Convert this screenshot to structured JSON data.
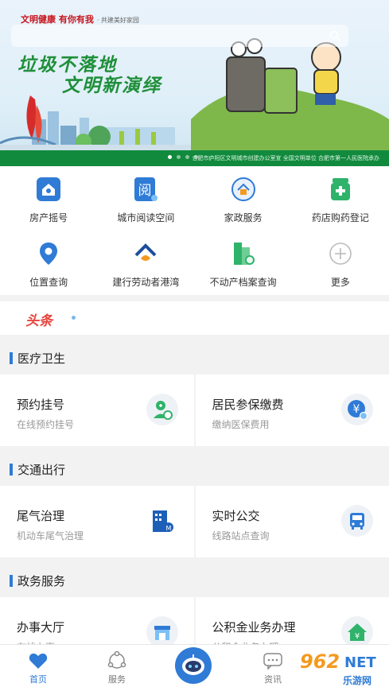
{
  "banner": {
    "topline": "文明健康 有你有我",
    "topline_small": "· 共建美好家园",
    "slogan_line1": "垃圾不落地",
    "slogan_line2": "文明新演绎",
    "strip_text": "合肥市庐阳区文明城市创建办公室宣  全国文明单位  合肥市第一人民医院承办",
    "dots_count": 4,
    "active_dot": 1
  },
  "grid": {
    "items": [
      {
        "label": "房产摇号",
        "icon": "house-lottery-icon",
        "color": "#2f7bd6"
      },
      {
        "label": "城市阅读空间",
        "icon": "reading-icon",
        "color": "#2f7bd6"
      },
      {
        "label": "家政服务",
        "icon": "housekeeping-icon",
        "color": "#2f7bd6"
      },
      {
        "label": "药店购药登记",
        "icon": "pharmacy-icon",
        "color": "#2fb36a"
      },
      {
        "label": "位置查询",
        "icon": "location-pin-icon",
        "color": "#2f7bd6"
      },
      {
        "label": "建行劳动者港湾",
        "icon": "ccb-harbor-icon",
        "color": "#2f7bd6"
      },
      {
        "label": "不动产档案查询",
        "icon": "property-archive-icon",
        "color": "#2fb36a"
      },
      {
        "label": "更多",
        "icon": "plus-circle-icon",
        "color": "#bbbbbb"
      }
    ]
  },
  "headline": {
    "logo": "头条"
  },
  "sections": [
    {
      "title": "医疗卫生",
      "cards": [
        {
          "title": "预约挂号",
          "sub": "在线预约挂号",
          "icon": "doctor-appointment-icon"
        },
        {
          "title": "居民参保缴费",
          "sub": "缴纳医保费用",
          "icon": "yuan-payment-icon"
        }
      ]
    },
    {
      "title": "交通出行",
      "cards": [
        {
          "title": "尾气治理",
          "sub": "机动车尾气治理",
          "icon": "exhaust-building-icon"
        },
        {
          "title": "实时公交",
          "sub": "线路站点查询",
          "icon": "bus-icon"
        }
      ]
    },
    {
      "title": "政务服务",
      "cards": [
        {
          "title": "办事大厅",
          "sub": "在线办事",
          "icon": "service-hall-icon"
        },
        {
          "title": "公积金业务办理",
          "sub": "公积金业务办理",
          "icon": "housing-fund-icon"
        }
      ]
    }
  ],
  "tabbar": {
    "tabs": [
      {
        "label": "首页",
        "icon": "heart-home-icon"
      },
      {
        "label": "服务",
        "icon": "service-molecule-icon"
      },
      {
        "label": "资讯",
        "icon": "chat-news-icon"
      }
    ]
  },
  "watermark": {
    "num": "962",
    "net": "NET",
    "site": "乐游网"
  },
  "colors": {
    "accent": "#2f7bd6",
    "green": "#128a3e"
  }
}
